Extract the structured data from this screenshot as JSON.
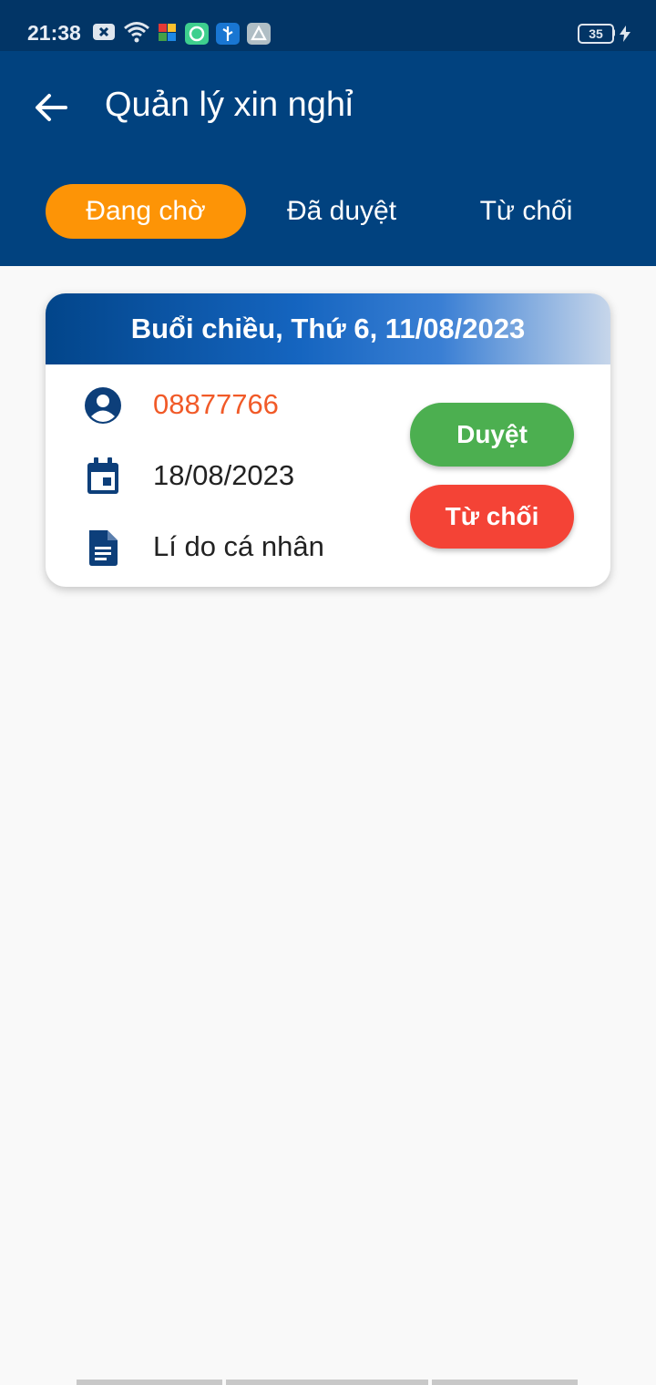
{
  "status_bar": {
    "time": "21:38",
    "battery": "35",
    "icons": [
      "notification-x-icon",
      "wifi-icon",
      "puzzle-app-icon",
      "chat-app-icon",
      "usb-icon",
      "share-icon"
    ],
    "background": "#023566"
  },
  "app_bar": {
    "title": "Quản lý xin nghỉ",
    "back_icon": "arrow-back-icon",
    "background": "#01427f"
  },
  "tabs": [
    {
      "label": "Đang chờ",
      "active": true
    },
    {
      "label": "Đã duyệt",
      "active": false
    },
    {
      "label": "Từ chối",
      "active": false
    }
  ],
  "accent": "#fd9406",
  "leave_request": {
    "header": "Buổi chiều, Thứ 6, 11/08/2023",
    "employee_code": "08877766",
    "date": "18/08/2023",
    "reason": "Lí do cá nhân",
    "approve_label": "Duyệt",
    "reject_label": "Từ chối",
    "approve_color": "#4caf50",
    "reject_color": "#f44336",
    "code_color": "#f15a28"
  }
}
